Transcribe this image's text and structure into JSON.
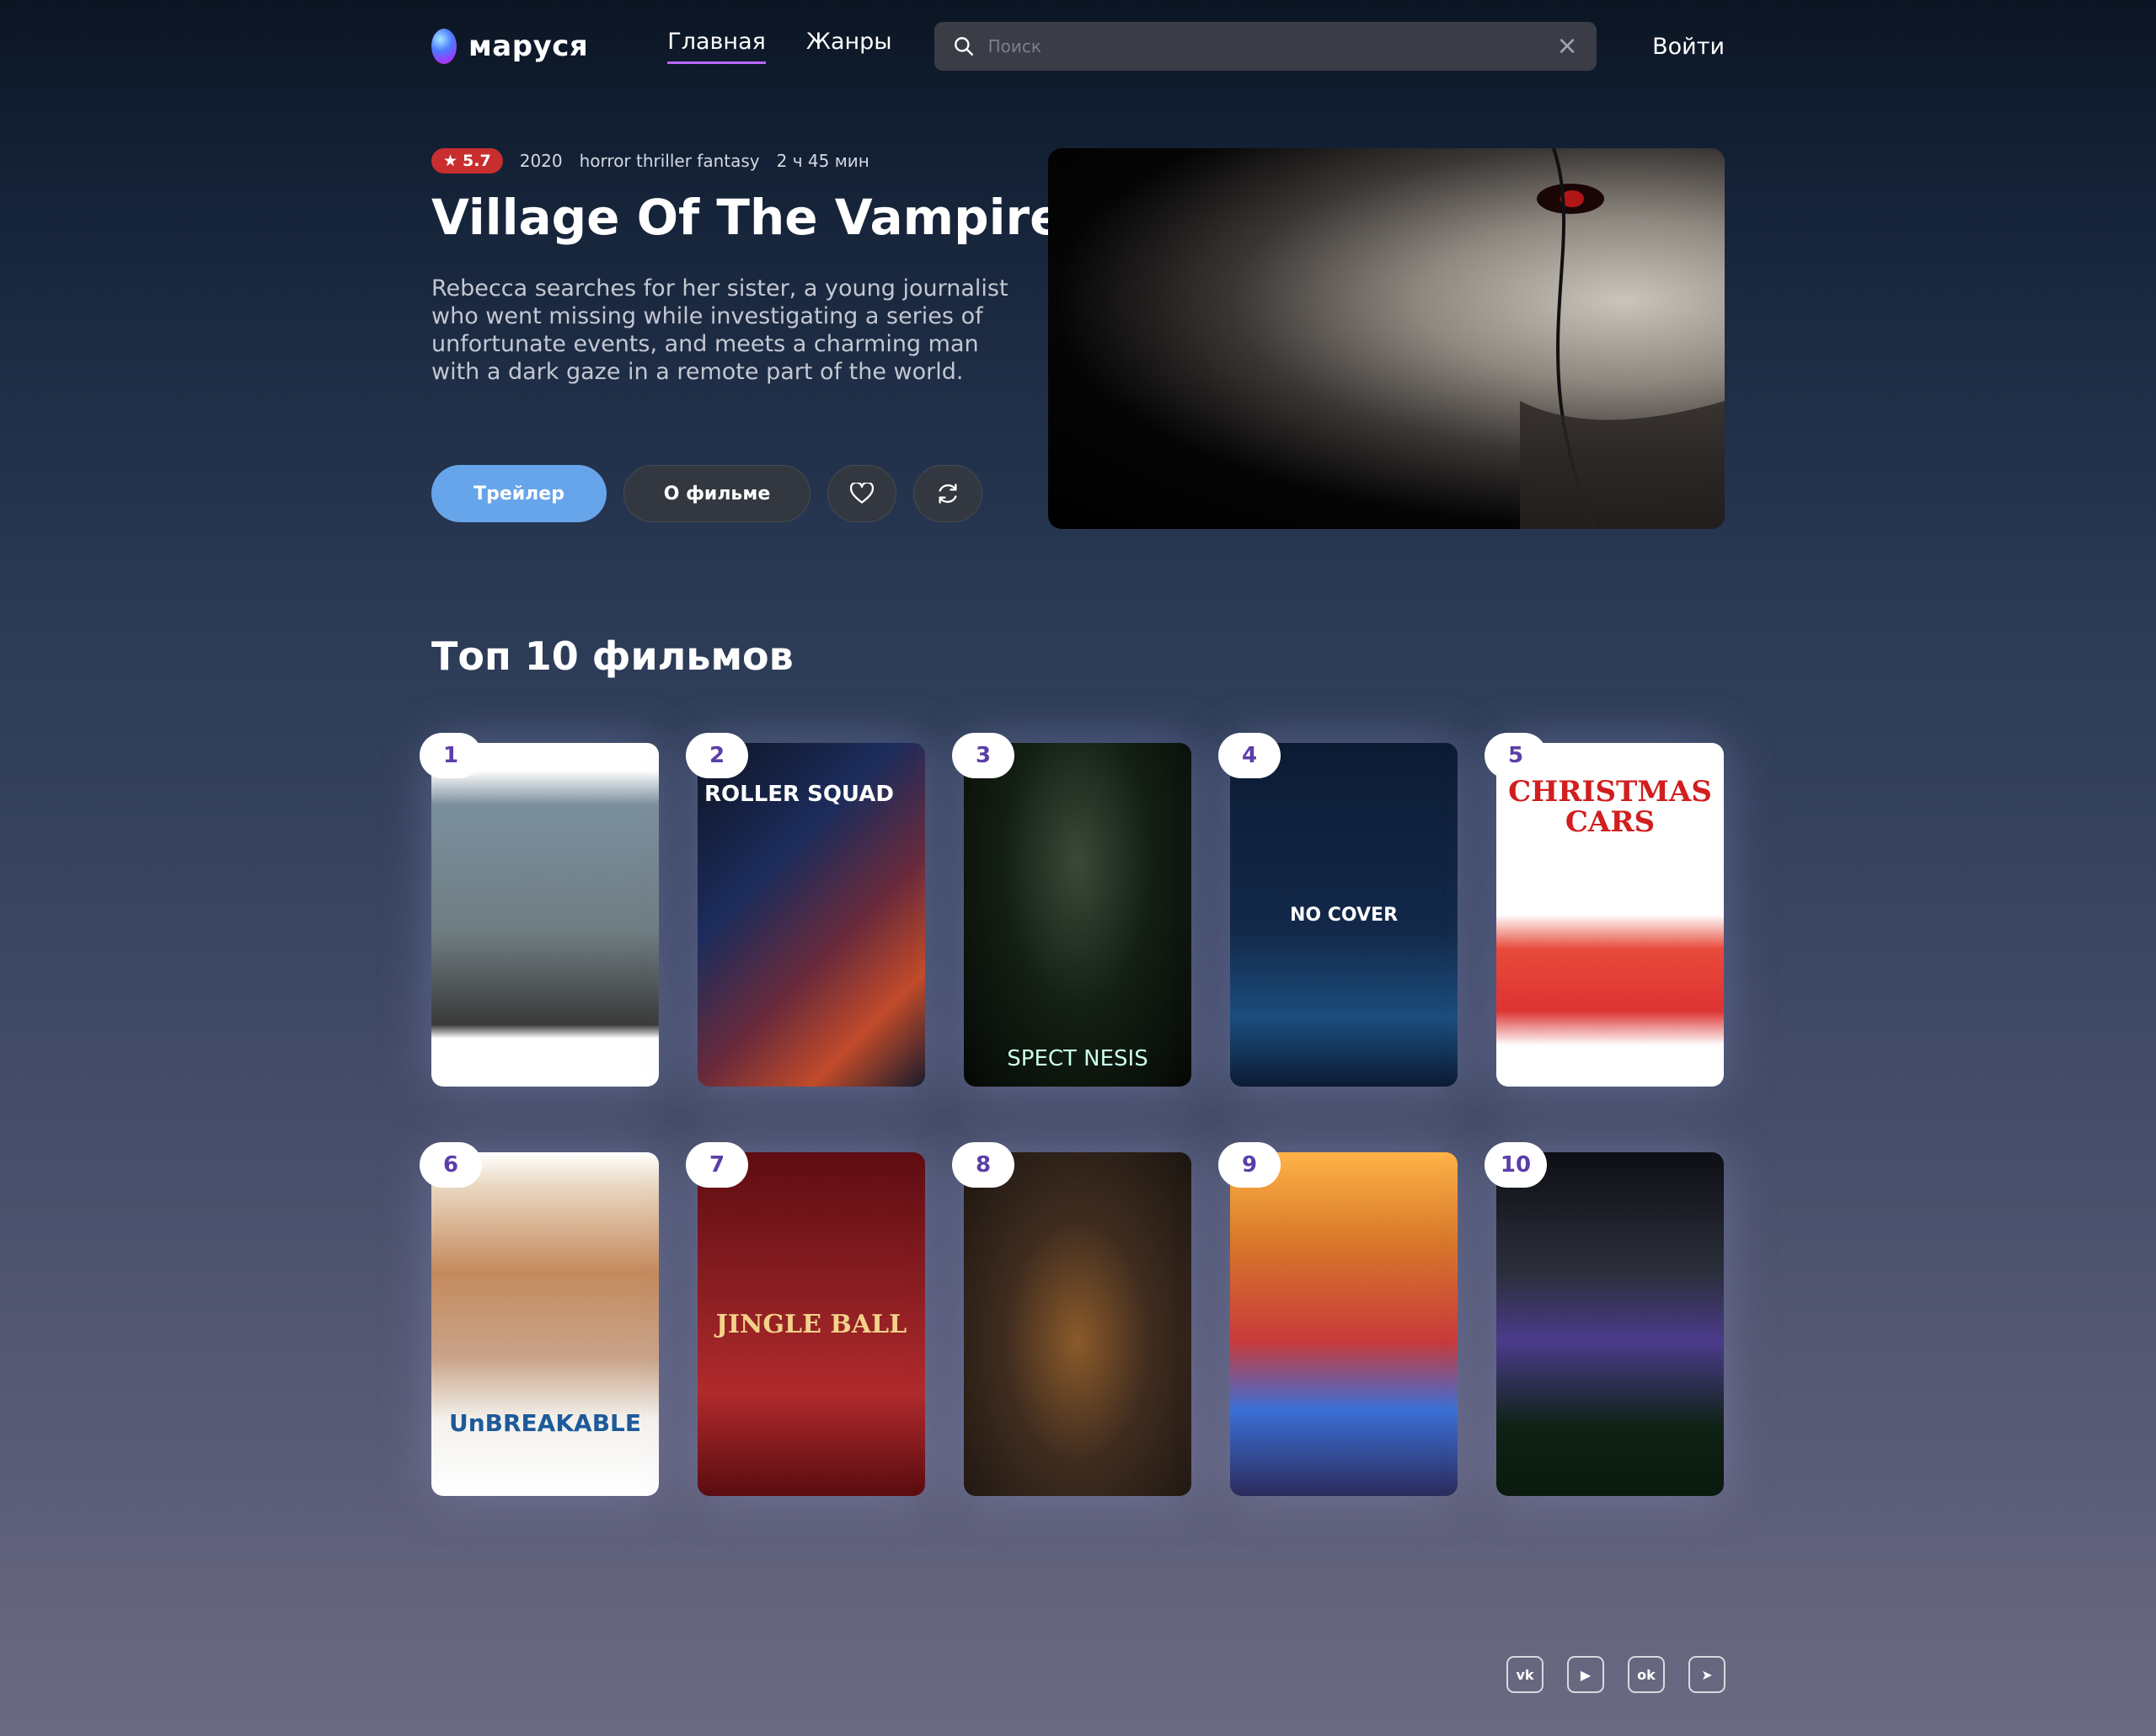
{
  "header": {
    "logo_text": "маруся",
    "nav": [
      {
        "label": "Главная",
        "active": true
      },
      {
        "label": "Жанры",
        "active": false
      }
    ],
    "search": {
      "placeholder": "Поиск",
      "value": ""
    },
    "login_label": "Войти"
  },
  "hero": {
    "rating": "5.7",
    "rating_color": "#c82e2e",
    "year": "2020",
    "genres": "horror thriller fantasy",
    "duration": "2 ч 45 мин",
    "title": "Village Of The Vampire",
    "description": "Rebecca searches for her sister, a young journalist who went missing while investigating a series of unfortunate events, and meets a charming man with a dark gaze in a remote part of the world.",
    "trailer_label": "Трейлер",
    "about_label": "О фильме",
    "accent_color": "#67a5ea"
  },
  "top10": {
    "title": "Топ 10 фильмов",
    "movies": [
      {
        "rank": "1",
        "poster_text": ""
      },
      {
        "rank": "2",
        "poster_text": "ROLLER SQUAD"
      },
      {
        "rank": "3",
        "poster_text": "SPECT NESIS"
      },
      {
        "rank": "4",
        "poster_text": "NO COVER"
      },
      {
        "rank": "5",
        "poster_text": "CHRISTMAS CARS"
      },
      {
        "rank": "6",
        "poster_text": "UnBREAKABLE"
      },
      {
        "rank": "7",
        "poster_text": "JINGLE BALL"
      },
      {
        "rank": "8",
        "poster_text": ""
      },
      {
        "rank": "9",
        "poster_text": ""
      },
      {
        "rank": "10",
        "poster_text": ""
      }
    ]
  },
  "footer": {
    "socials": [
      {
        "icon": "vk-icon",
        "label": "vk"
      },
      {
        "icon": "youtube-icon",
        "label": "▶"
      },
      {
        "icon": "odnoklassniki-icon",
        "label": "ok"
      },
      {
        "icon": "telegram-icon",
        "label": "➤"
      }
    ]
  }
}
